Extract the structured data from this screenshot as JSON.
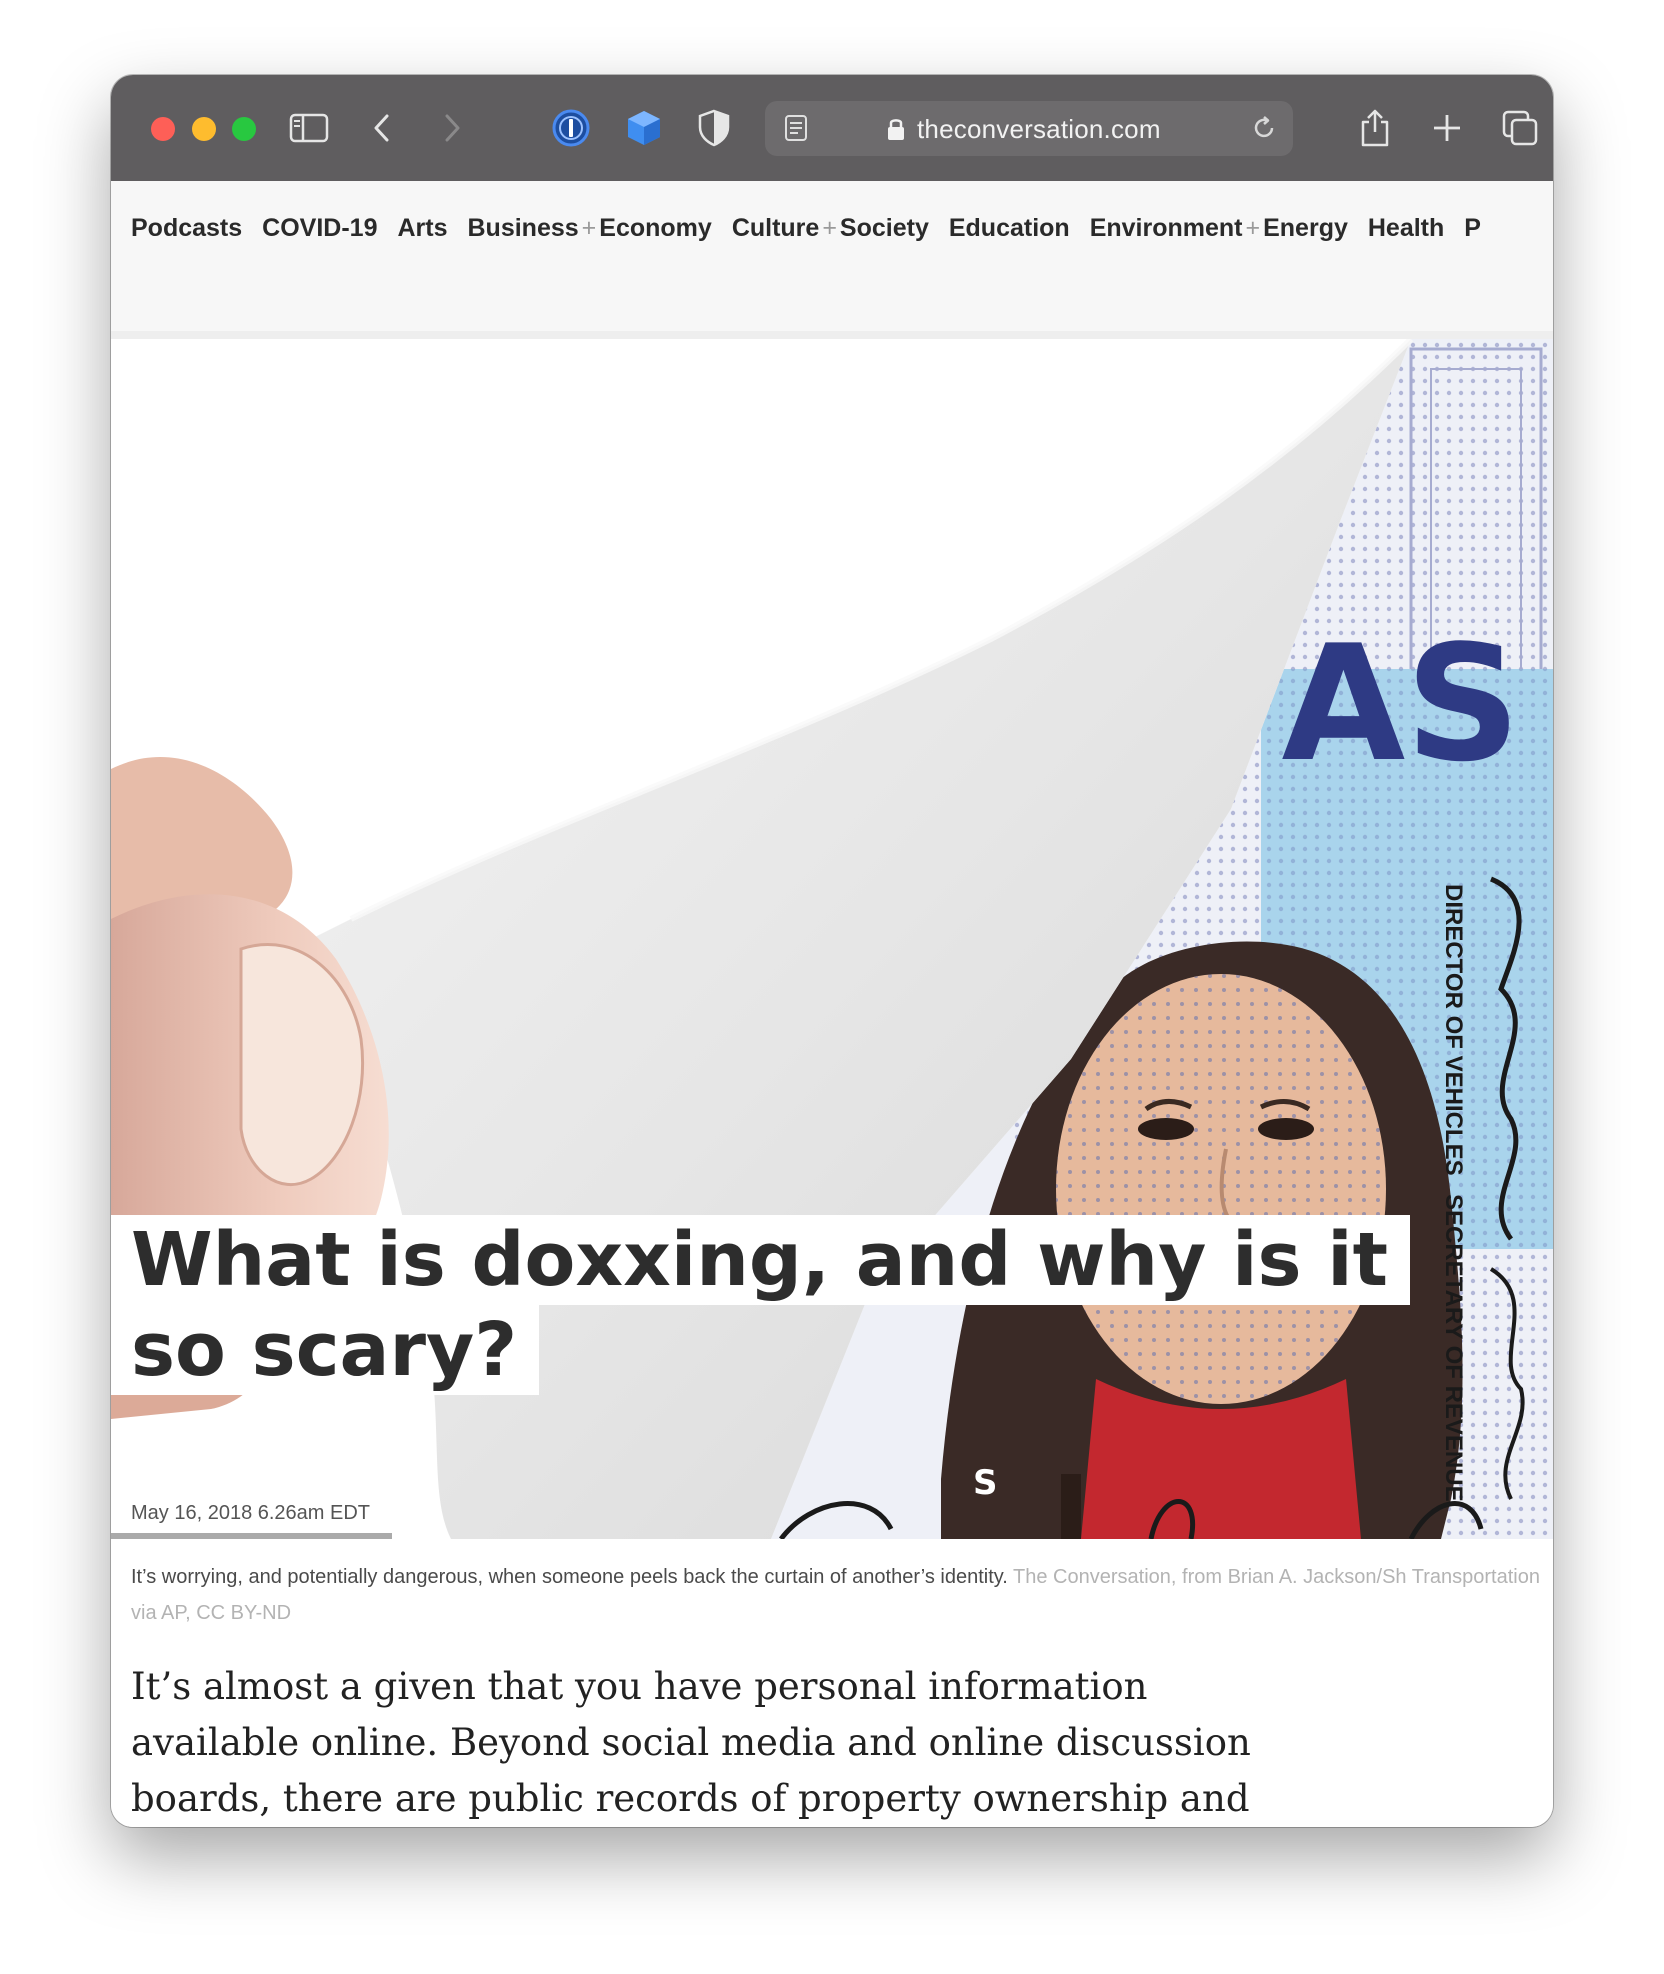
{
  "browser": {
    "url": "theconversation.com",
    "icons": {
      "sidebar": "sidebar-icon",
      "back": "chevron-left-icon",
      "forward": "chevron-right-icon",
      "password_manager": "1password-icon",
      "extension": "cube-icon",
      "privacy": "shield-icon",
      "reader": "reader-icon",
      "lock": "lock-icon",
      "reload": "reload-icon",
      "share": "share-icon",
      "new_tab": "plus-icon",
      "tabs": "tab-overview-icon"
    },
    "colors": {
      "toolbar": "#5f5d5f",
      "close": "#fe5f57",
      "minimize": "#febc2e",
      "zoom": "#28c840"
    }
  },
  "nav": {
    "items": [
      {
        "label": "Podcasts"
      },
      {
        "label": "COVID-19"
      },
      {
        "label": "Arts"
      },
      {
        "label": "Business",
        "label2": "Economy"
      },
      {
        "label": "Culture",
        "label2": "Society"
      },
      {
        "label": "Education"
      },
      {
        "label": "Environment",
        "label2": "Energy"
      },
      {
        "label": "Health"
      },
      {
        "label": "P"
      }
    ],
    "separator": "+"
  },
  "article": {
    "headline_line1": "What is doxxing, and why is it",
    "headline_line2": "so scary?",
    "date": "May 16, 2018 6.26am EDT",
    "caption": "It’s worrying, and potentially dangerous, when someone peels back the curtain of another’s identity.",
    "credit": "The Conversation, from Brian A. Jackson/Sh Transportation via AP, CC BY-ND",
    "body": "It’s almost a given that you have personal information available online. Beyond social media and online discussion boards, there are public records of property ownership and voter registration"
  },
  "image": {
    "id_card_letters": "AS",
    "id_card_label_1": "DIRECTOR OF VEHICLES",
    "id_card_label_2": "SECRETARY OF REVENUE",
    "id_card_letter_small": "S"
  }
}
